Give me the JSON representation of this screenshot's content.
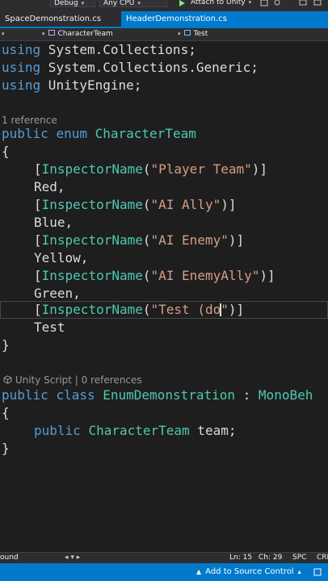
{
  "toolbar": {
    "config": "Debug",
    "platform": "Any CPU",
    "attach": "Attach to Unity"
  },
  "tabs": [
    {
      "label": "SpaceDemonstration.cs"
    },
    {
      "label": "HeaderDemonstration.cs"
    }
  ],
  "navbar": {
    "type": "CharacterTeam",
    "member": "Test"
  },
  "code": {
    "using1": {
      "kw": "using",
      "rest": " System.Collections;"
    },
    "using2": {
      "kw": "using",
      "rest": " System.Collections.Generic;"
    },
    "using3": {
      "kw": "using",
      "rest": " UnityEngine;"
    },
    "lens1": "1 reference",
    "enum_decl": {
      "kw1": "public",
      "kw2": "enum",
      "name": "CharacterTeam"
    },
    "open_brace": "{",
    "close_brace": "}",
    "attr_name": "InspectorName",
    "members": [
      {
        "label": "\"Player Team\"",
        "value": "Red,"
      },
      {
        "label": "\"AI Ally\"",
        "value": "Blue,"
      },
      {
        "label": "\"AI Enemy\"",
        "value": "Yellow,"
      },
      {
        "label": "\"AI EnemyAlly\"",
        "value": "Green,"
      }
    ],
    "editing": {
      "before_caret": "\"Test (do",
      "after_caret": "\""
    },
    "last_member": "Test",
    "lens2": {
      "unity": "Unity Script",
      "sep": " | ",
      "refs": "0 references"
    },
    "class_decl": {
      "kw1": "public",
      "kw2": "class",
      "name": "EnumDemonstration",
      "colon": " : ",
      "base": "MonoBeh"
    },
    "field": {
      "kw": "public",
      "type": "CharacterTeam",
      "name": " team;"
    }
  },
  "editor_status": {
    "left": "ound",
    "ln": "Ln: 15",
    "ch": "Ch: 29",
    "mode": "SPC",
    "eol": "CRL"
  },
  "statusbar": {
    "source_control": "Add to Source Control"
  },
  "colors": {
    "keyword": "#569cd6",
    "type": "#4ec9b0",
    "string": "#d69d85",
    "accent": "#007acc"
  }
}
